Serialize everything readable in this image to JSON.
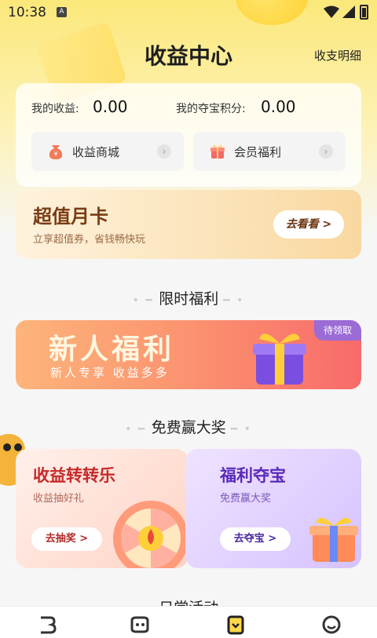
{
  "status_bar": {
    "time": "10:38",
    "notification_icon": "A"
  },
  "header": {
    "title": "收益中心",
    "detail_link": "收支明细"
  },
  "earnings": {
    "income_label": "我的收益:",
    "income_value": "0.00",
    "points_label": "我的夺宝积分:",
    "points_value": "0.00",
    "shop_label": "收益商城",
    "vip_label": "会员福利"
  },
  "monthly_card": {
    "title": "超值月卡",
    "subtitle": "立享超值券，省钱畅快玩",
    "button": "去看看 >"
  },
  "limited_section": {
    "title": "限时福利"
  },
  "newbie_banner": {
    "title": "新人福利",
    "subtitle": "新人专享  收益多多",
    "badge": "待领取"
  },
  "prize_section": {
    "title": "免费赢大奖"
  },
  "wheel_card": {
    "title": "收益转转乐",
    "subtitle": "收益抽好礼",
    "button": "去抽奖 >"
  },
  "treasure_card": {
    "title": "福利夺宝",
    "subtitle": "免费赢大奖",
    "button": "去夺宝 >"
  },
  "daily_section": {
    "title": "日常活动"
  },
  "colors": {
    "accent_yellow": "#fbe87a",
    "brand_red": "#c62a2a",
    "purple": "#5a2ab8"
  }
}
